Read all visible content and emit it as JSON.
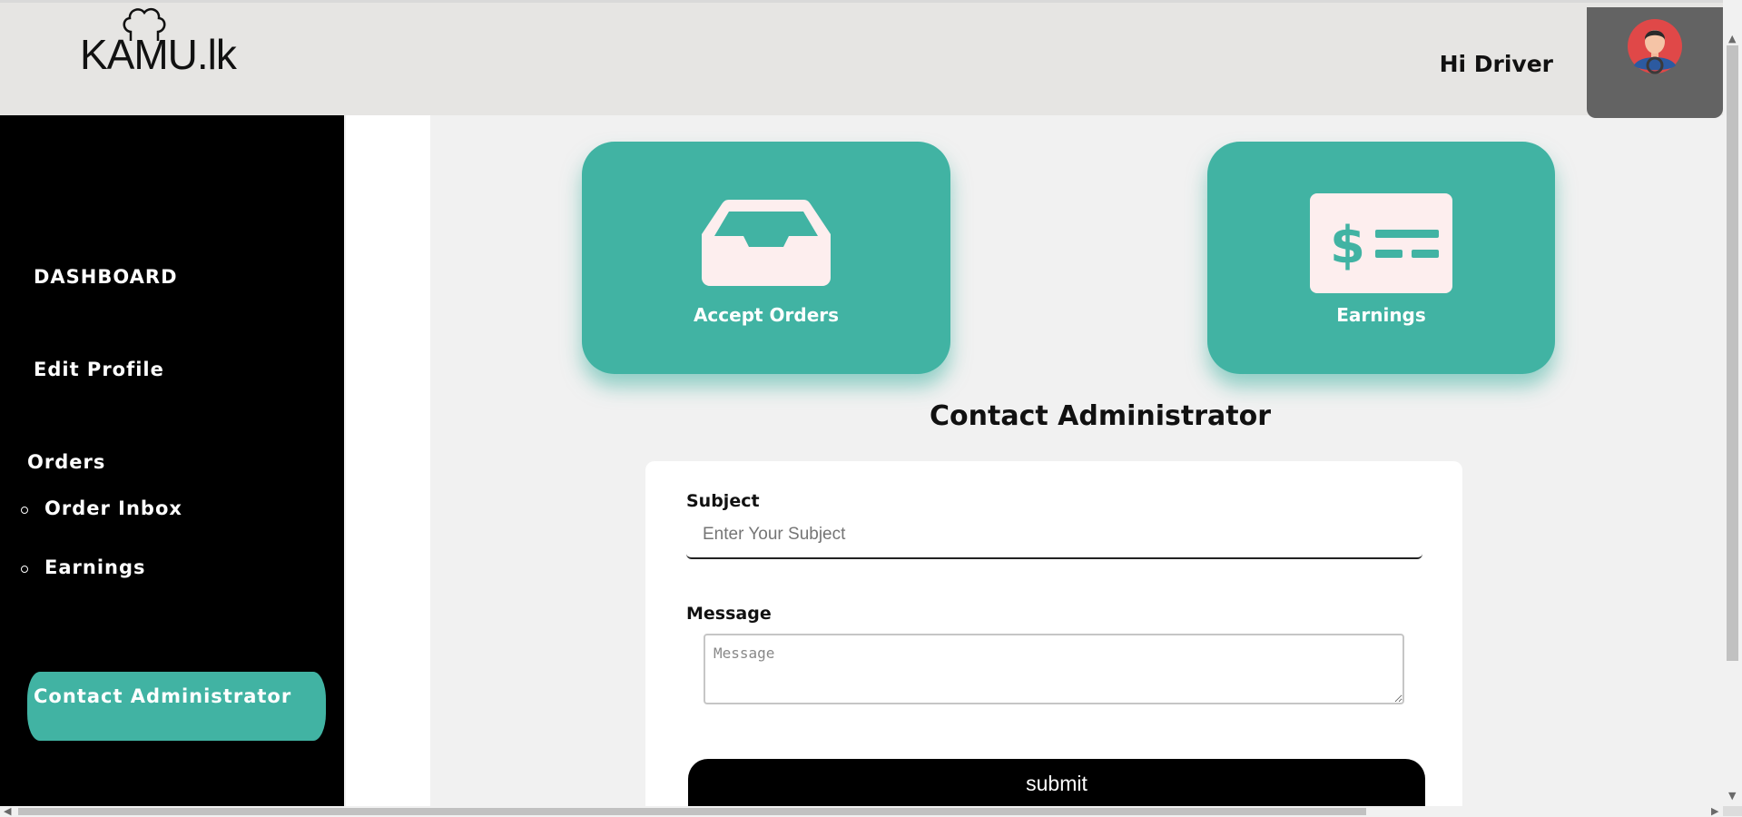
{
  "header": {
    "logo_text": "KAMU.lk",
    "greeting": "Hi Driver",
    "avatar_icon": "driver-avatar-icon"
  },
  "sidebar": {
    "dashboard": "DASHBOARD",
    "edit_profile": "Edit Profile",
    "orders": "Orders",
    "order_inbox": "Order Inbox",
    "earnings": "Earnings",
    "contact_admin": "Contact Administrator"
  },
  "cards": [
    {
      "label": "Accept Orders",
      "icon": "inbox-icon"
    },
    {
      "label": "Earnings",
      "icon": "bill-icon"
    }
  ],
  "contact": {
    "title": "Contact Administrator",
    "subject_label": "Subject",
    "subject_placeholder": "Enter Your Subject",
    "message_label": "Message",
    "message_placeholder": "Message",
    "submit_label": "submit"
  },
  "colors": {
    "accent": "#41b3a3",
    "sidebar_bg": "#000000",
    "header_bg": "#e6e5e3",
    "icon_fill": "#fdeeee"
  }
}
